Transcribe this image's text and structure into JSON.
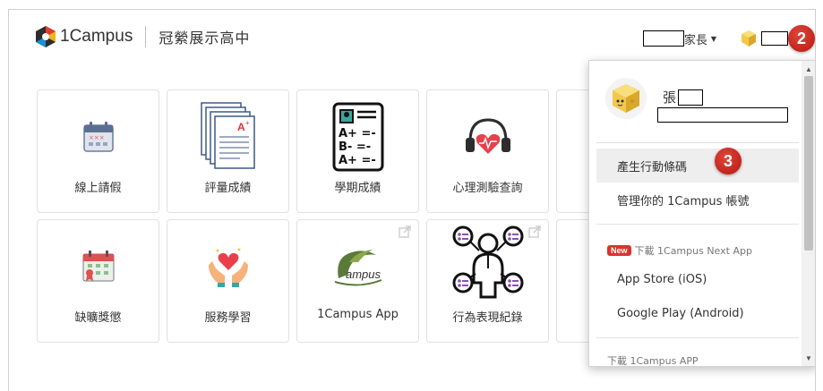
{
  "header": {
    "logo_text": "1Campus",
    "school_name": "冠縈展示高中",
    "role_label": "家長",
    "step_badge": "2"
  },
  "tiles": [
    {
      "label": "線上請假",
      "icon": "calendar-leave-icon"
    },
    {
      "label": "評量成績",
      "icon": "exam-papers-icon"
    },
    {
      "label": "學期成績",
      "icon": "grade-report-icon"
    },
    {
      "label": "心理測驗查詢",
      "icon": "heart-headphones-icon"
    },
    {
      "label": "缺曠獎懲",
      "icon": "attendance-award-icon"
    },
    {
      "label": "服務學習",
      "icon": "hands-heart-icon"
    },
    {
      "label": "1Campus App",
      "icon": "ampus-logo-icon",
      "logo_text": "ampus"
    },
    {
      "label": "行為表現紀錄",
      "icon": "behavior-record-icon"
    }
  ],
  "dropdown": {
    "user_name_prefix": "張",
    "step_badge": "3",
    "items": {
      "generate_code": "產生行動條碼",
      "manage_account": "管理你的 1Campus 帳號",
      "new_badge": "New",
      "next_app_section": "下載 1Campus Next App",
      "app_store": "App Store (iOS)",
      "google_play": "Google Play (Android)",
      "app_section": "下載 1Campus APP"
    }
  },
  "colors": {
    "badge_red": "#c9251b",
    "tile_border": "#e1e1e1",
    "active_item_bg": "#eeeeee"
  }
}
